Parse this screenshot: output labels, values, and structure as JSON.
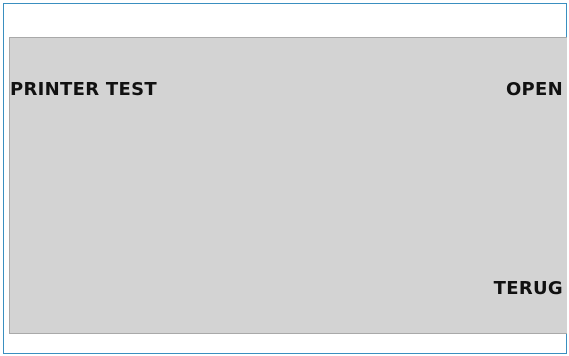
{
  "screen": {
    "title": "PRINTER TEST",
    "open_label": "OPEN",
    "back_label": "TERUG"
  },
  "colors": {
    "frame_border": "#3a8fc0",
    "screen_bg": "#d3d3d3",
    "text": "#111111"
  }
}
